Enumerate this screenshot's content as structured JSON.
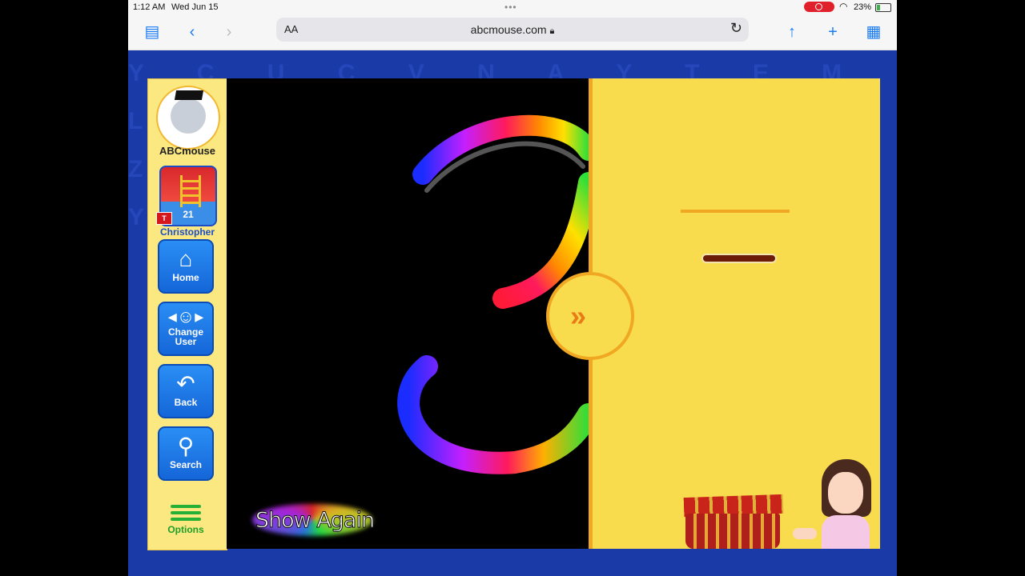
{
  "status_bar": {
    "time": "1:12 AM",
    "date": "Wed Jun 15",
    "battery": "23%"
  },
  "browser": {
    "aa_label": "AA",
    "url": "abcmouse.com"
  },
  "sidebar": {
    "brand": "ABCmouse",
    "avatar": {
      "level": "21",
      "tag": "T"
    },
    "user_name": "Christopher",
    "buttons": {
      "home": "Home",
      "change_user": "Change User",
      "back": "Back",
      "search": "Search",
      "options": "Options"
    }
  },
  "board": {
    "show_again": "Show Again",
    "traced_digit": "3"
  },
  "colors": {
    "sidebar_bg": "#fbe880",
    "button_blue": "#1a7cf5",
    "panel_yellow": "#f9dc4e",
    "arrow_orange": "#e87b16"
  },
  "background_letters": "Y C U C V N A Y T E M L O Y X C Y U Q V N A Z J T X P F O Z E V P Y T R X Z S T X P"
}
